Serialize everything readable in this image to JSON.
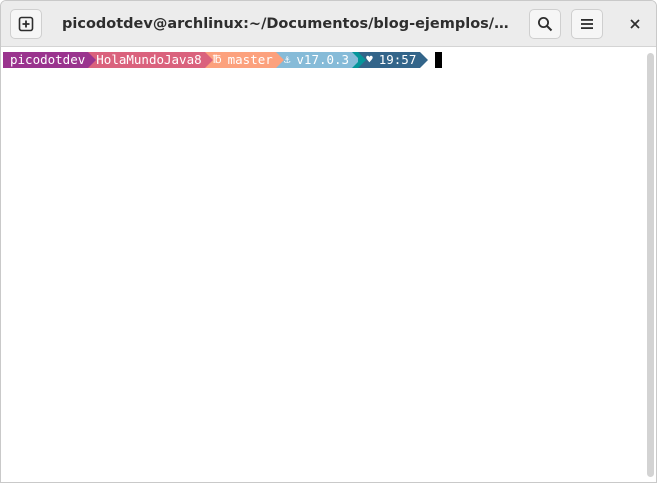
{
  "window": {
    "title": "picodotdev@archlinux:~/Documentos/blog-ejemplos/HolaMun..."
  },
  "headerbar": {
    "new_tab_icon": "new-tab-plus-icon",
    "search_icon": "search-icon",
    "menu_icon": "hamburger-menu-icon",
    "close_icon": "close-icon"
  },
  "prompt": {
    "user": "picodotdev",
    "directory": "HolaMundoJava8",
    "git_icon": "℔",
    "git_branch": "master",
    "java_icon": "⚓",
    "java_version": "v17.0.3",
    "time_icon": "♥",
    "time": "19:57"
  },
  "colors": {
    "user_segment": "#9a348e",
    "directory_segment": "#da627d",
    "git_segment": "#fca17d",
    "java_segment": "#86bbd8",
    "pad_segment": "#06969a",
    "time_segment": "#33658a"
  }
}
